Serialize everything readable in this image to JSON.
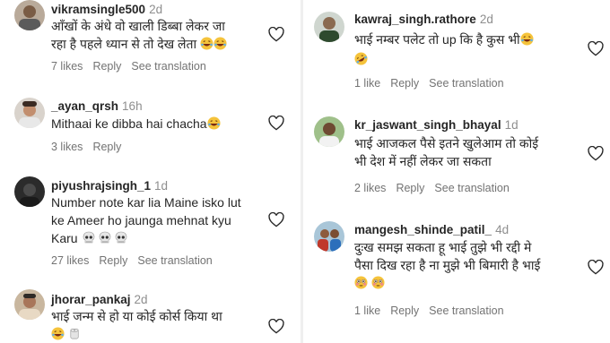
{
  "left_column": {
    "comments": [
      {
        "username": "vikramsingle500",
        "time": "2d",
        "lines": [
          "आँखों के अंधे वो खाली डिब्बा लेकर जा",
          "रहा है पहले ध्यान से तो देख लेता"
        ],
        "line_emoji": [
          "",
          "😂😂"
        ],
        "likes": "7 likes",
        "reply": "Reply",
        "translate": "See translation"
      },
      {
        "username": "_ayan_qrsh",
        "time": "16h",
        "lines": [
          "Mithaai ke dibba hai chacha"
        ],
        "line_emoji": [
          "😂"
        ],
        "likes": "3 likes",
        "reply": "Reply",
        "translate": ""
      },
      {
        "username": "piyushrajsingh_1",
        "time": "1d",
        "lines": [
          "Number note kar lia Maine isko lut",
          "ke Ameer ho jaunga mehnat kyu",
          "Karu"
        ],
        "line_emoji": [
          "",
          "",
          "💀💀💀"
        ],
        "likes": "27 likes",
        "reply": "Reply",
        "translate": "See translation"
      },
      {
        "username": "jhorar_pankaj",
        "time": "2d",
        "lines": [
          "भाई जन्म से हो या कोई कोर्स किया था",
          ""
        ],
        "line_emoji": [
          "",
          "😂🧻"
        ],
        "likes": "",
        "reply": "",
        "translate": ""
      }
    ]
  },
  "right_column": {
    "comments": [
      {
        "username": "kawraj_singh.rathore",
        "time": "2d",
        "lines": [
          "भाई नम्बर पलेट तो up कि है कुस भी",
          ""
        ],
        "line_emoji": [
          "😂",
          "😂"
        ],
        "likes": "1 like",
        "reply": "Reply",
        "translate": "See translation"
      },
      {
        "username": "kr_jaswant_singh_bhayal",
        "time": "1d",
        "lines": [
          "भाई आजकल पैसे इतने खुलेआम तो कोई",
          "भी देश में नहीं लेकर जा सकता"
        ],
        "line_emoji": [
          "",
          ""
        ],
        "likes": "2 likes",
        "reply": "Reply",
        "translate": "See translation"
      },
      {
        "username": "mangesh_shinde_patil_",
        "time": "4d",
        "lines": [
          "दुःख समझ सकता हू भाई तुझे भी रद्दी मे",
          "पैसा दिख रहा है ना मुझे भी बिमारी है भाई",
          ""
        ],
        "line_emoji": [
          "",
          "",
          "😳😳"
        ],
        "likes": "1 like",
        "reply": "Reply",
        "translate": "See translation"
      }
    ]
  },
  "colors": {
    "text": "#262626",
    "muted": "#737373",
    "time": "#8e8e8e"
  }
}
